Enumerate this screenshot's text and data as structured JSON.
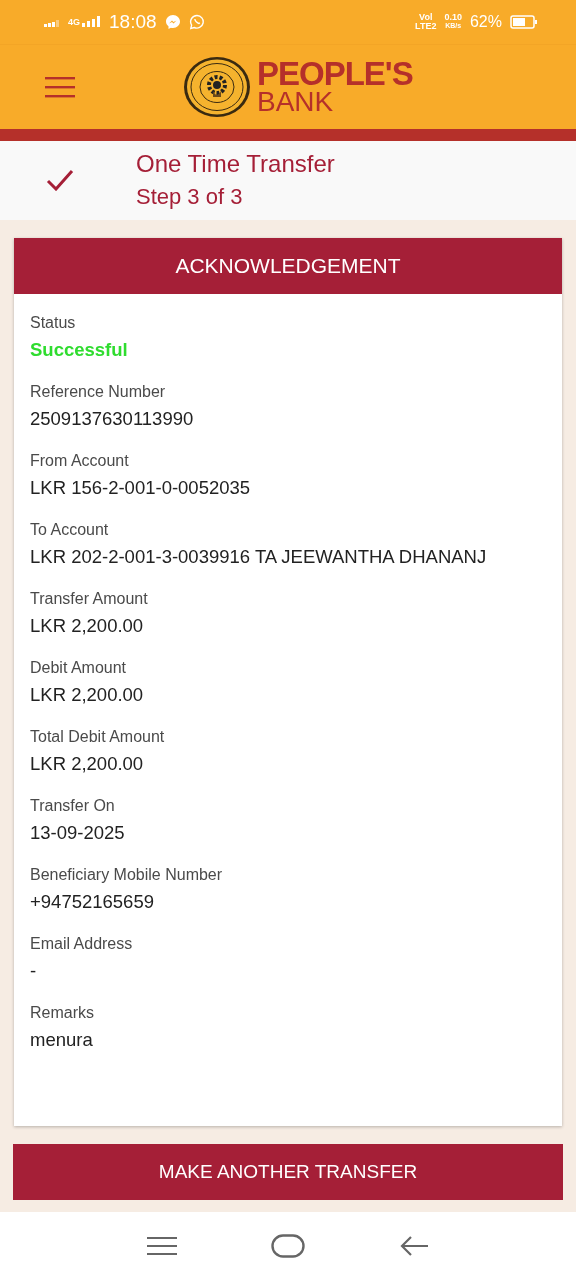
{
  "status_bar": {
    "network": "4G",
    "time": "18:08",
    "volte": "Vol",
    "lte": "LTE2",
    "speed": "0.10",
    "speed_unit": "KB/s",
    "battery": "62%"
  },
  "header": {
    "brand_line_1": "PEOPLE'S",
    "brand_line_2": "BANK"
  },
  "step": {
    "title": "One Time Transfer",
    "subtitle": "Step 3 of 3",
    "completed": true
  },
  "card": {
    "title": "ACKNOWLEDGEMENT",
    "fields": [
      {
        "label": "Status",
        "value": "Successful",
        "kind": "status"
      },
      {
        "label": "Reference Number",
        "value": "2509137630113990",
        "kind": "text"
      },
      {
        "label": "From Account",
        "value": "LKR 156-2-001-0-0052035",
        "kind": "text"
      },
      {
        "label": "To Account",
        "value": "LKR 202-2-001-3-0039916 TA JEEWANTHA DHANANJ",
        "kind": "text"
      },
      {
        "label": "Transfer Amount",
        "value": "LKR 2,200.00",
        "kind": "text"
      },
      {
        "label": "Debit Amount",
        "value": "LKR 2,200.00",
        "kind": "text"
      },
      {
        "label": "Total Debit Amount",
        "value": "LKR 2,200.00",
        "kind": "text"
      },
      {
        "label": "Transfer On",
        "value": "13-09-2025",
        "kind": "text"
      },
      {
        "label": "Beneficiary Mobile Number",
        "value": "+94752165659",
        "kind": "text"
      },
      {
        "label": "Email Address",
        "value": "-",
        "kind": "text"
      },
      {
        "label": "Remarks",
        "value": "menura",
        "kind": "text"
      }
    ]
  },
  "button": {
    "label": "MAKE ANOTHER TRANSFER"
  }
}
